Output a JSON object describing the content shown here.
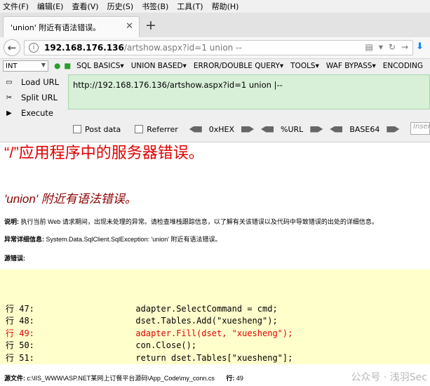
{
  "menu": [
    "文件(F)",
    "编辑(E)",
    "查看(V)",
    "历史(S)",
    "书签(B)",
    "工具(T)",
    "帮助(H)"
  ],
  "tab": {
    "title": "'union' 附近有语法错误。",
    "close_icon": "close-icon"
  },
  "nav": {
    "url_host": "192.168.176.136",
    "url_path": "/artshow.aspx?id=1 union --"
  },
  "hackbar": {
    "select_value": "INT",
    "menus": [
      "SQL BASICS▾",
      "UNION BASED▾",
      "ERROR/DOUBLE QUERY▾",
      "TOOLS▾",
      "WAF BYPASS▾",
      "ENCODING"
    ],
    "load_url": "Load URL",
    "split_url": "Split URL",
    "execute": "Execute",
    "textarea": "http://192.168.176.136/artshow.aspx?id=1 union |--",
    "post_data": "Post data",
    "referrer": "Referrer",
    "hex": "0xHEX",
    "url_enc": "%URL",
    "base64": "BASE64",
    "insert": "Inser"
  },
  "page": {
    "heading": "“/”应用程序中的服务器错误。",
    "message": "'union' 附近有语法错误。",
    "desc_label": "说明:",
    "desc_text": " 执行当前 Web 请求期间，出现未处理的异常。请检查堆栈跟踪信息，以了解有关该错误以及代码中导致错误的出处的详细信息。",
    "exc_label": "异常详细信息:",
    "exc_text": " System.Data.SqlClient.SqlException: 'union' 附近有语法错误。",
    "src_label": "源错误:",
    "code_lines": [
      {
        "text": "行 47:                    adapter.SelectCommand = cmd;",
        "error": false
      },
      {
        "text": "行 48:                    dset.Tables.Add(\"xuesheng\");",
        "error": false
      },
      {
        "text": "行 49:                    adapter.Fill(dset, \"xuesheng\");",
        "error": true
      },
      {
        "text": "行 50:                    con.Close();",
        "error": false
      },
      {
        "text": "行 51:                    return dset.Tables[\"xuesheng\"];",
        "error": false
      }
    ],
    "file_label": "源文件:",
    "file_text": " c:\\IIS_WWW\\ASP.NET某网上订餐平台源码\\App_Code\\my_conn.cs",
    "line_label": "行:",
    "line_text": " 49"
  },
  "watermark": "公众号 · 浅羽Sec"
}
